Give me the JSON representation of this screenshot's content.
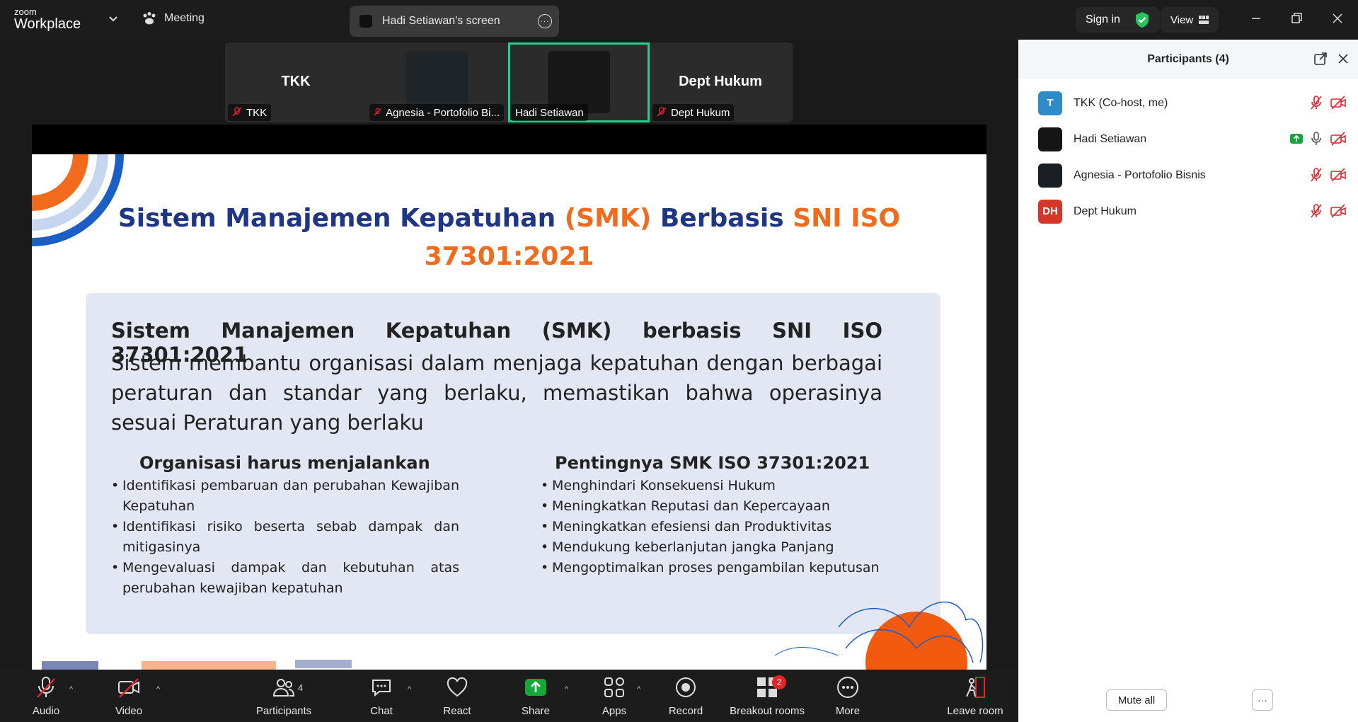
{
  "app": {
    "brand_small": "zoom",
    "brand_big": "Workplace"
  },
  "topbar": {
    "meeting_label": "Meeting",
    "screen_share_label": "Hadi Setiawan's screen",
    "sign_in": "Sign in",
    "view": "View"
  },
  "thumbnails": [
    {
      "big_name": "TKK",
      "tag": "TKK",
      "muted": true
    },
    {
      "big_name": "",
      "tag": "Agnesia - Portofolio Bi...",
      "muted": true
    },
    {
      "big_name": "",
      "tag": "Hadi Setiawan",
      "muted": false,
      "active": true
    },
    {
      "big_name": "Dept Hukum",
      "tag": "Dept Hukum",
      "muted": true
    }
  ],
  "slide": {
    "title_part1": "Sistem Manajemen Kepatuhan ",
    "title_part2": "(SMK)",
    "title_part3": " Berbasis ",
    "title_part4": "SNI ISO 37301:2021",
    "card_heading": "Sistem Manajemen Kepatuhan (SMK) berbasis SNI ISO 37301:2021",
    "card_body": "Sistem membantu organisasi dalam menjaga kepatuhan dengan berbagai peraturan dan standar yang berlaku, memastikan bahwa operasinya sesuai Peraturan yang berlaku",
    "left_heading": "Organisasi harus menjalankan",
    "left_items": [
      "Identifikasi pembaruan dan perubahan Kewajiban Kepatuhan",
      "Identifikasi risiko beserta sebab dampak dan mitigasinya",
      "Mengevaluasi dampak dan kebutuhan atas perubahan kewajiban kepatuhan"
    ],
    "right_heading": "Pentingnya SMK ISO 37301:2021",
    "right_items": [
      "Menghindari Konsekuensi Hukum",
      "Meningkatkan Reputasi dan  Kepercayaan",
      "Meningkatkan efesiensi dan Produktivitas",
      "Mendukung keberlanjutan jangka Panjang",
      "Mengoptimalkan proses pengambilan keputusan"
    ],
    "accent_blue": "#1f3585",
    "accent_orange": "#f26a1b"
  },
  "participants_panel": {
    "title": "Participants (4)",
    "participants": [
      {
        "name": "TKK (Co-host, me)",
        "initials": "T",
        "avatar_color": "#2d8cc9",
        "sharing": false,
        "mic": "muted"
      },
      {
        "name": "Hadi Setiawan",
        "initials": "",
        "avatar_color": "#151515",
        "sharing": true,
        "mic": "on"
      },
      {
        "name": "Agnesia - Portofolio Bisnis",
        "initials": "",
        "avatar_color": "#1b1f24",
        "sharing": false,
        "mic": "muted"
      },
      {
        "name": "Dept Hukum",
        "initials": "DH",
        "avatar_color": "#d6362a",
        "sharing": false,
        "mic": "muted"
      }
    ],
    "mute_all": "Mute all",
    "more": "···"
  },
  "toolbar": {
    "audio": "Audio",
    "video": "Video",
    "participants": "Participants",
    "participants_count": "4",
    "chat": "Chat",
    "react": "React",
    "share": "Share",
    "apps": "Apps",
    "record": "Record",
    "breakout": "Breakout rooms",
    "breakout_badge": "2",
    "more": "More",
    "leave": "Leave room"
  },
  "colors": {
    "active_speaker": "#23d18b",
    "share_green": "#14a83b",
    "muted_red": "#e0262b"
  }
}
